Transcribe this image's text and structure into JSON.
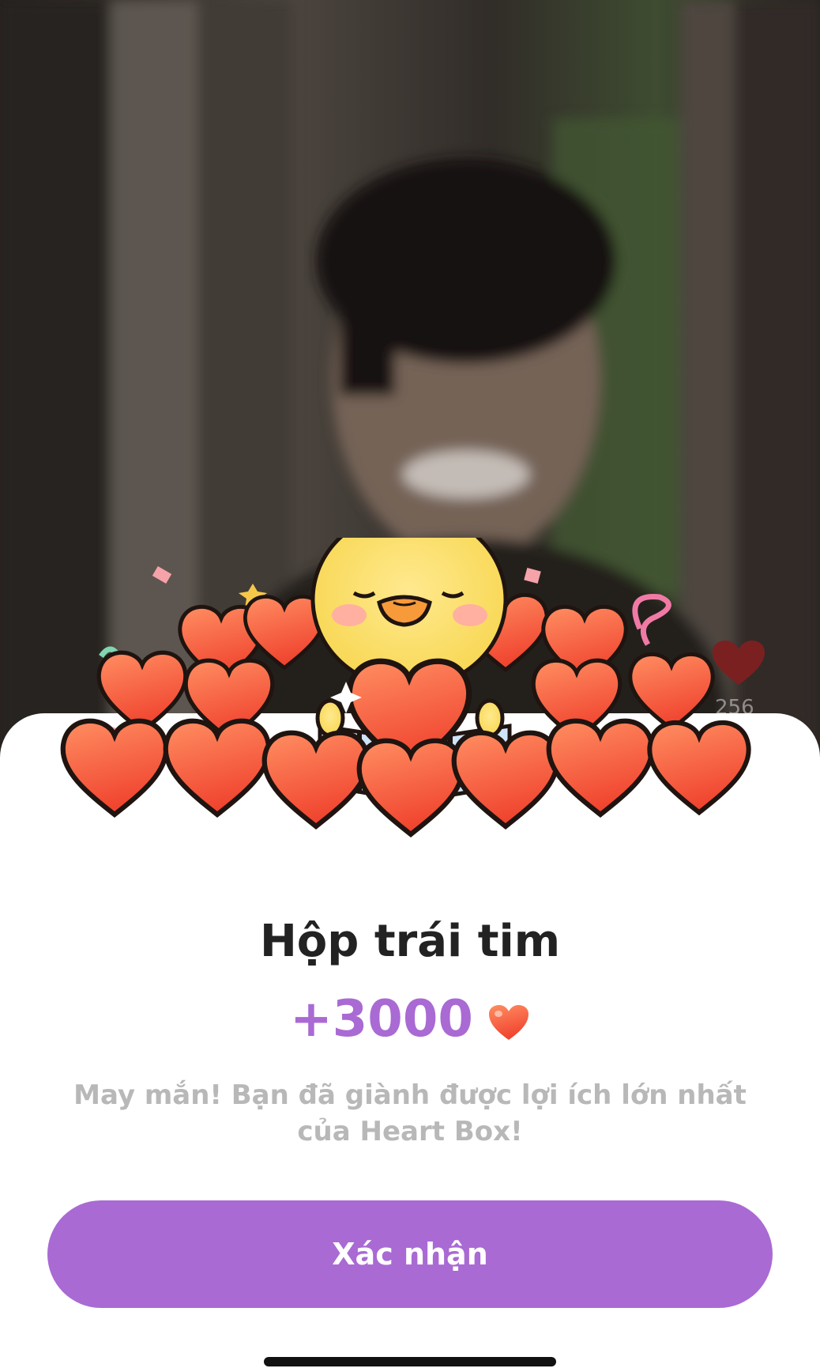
{
  "background": {
    "like_icon": "heart-icon",
    "like_count": "256"
  },
  "popup": {
    "illustration_icon": "chick-holding-heart-icon",
    "title": "Hộp trái tim",
    "reward_amount": "+3000",
    "reward_icon": "heart-icon",
    "message": "May mắn! Bạn đã giành được lợi ích lớn nhất của Heart Box!",
    "confirm_label": "Xác nhận"
  },
  "colors": {
    "accent": "#a96ad4",
    "title": "#222222",
    "message": "#b8b8b8",
    "heart": "#f0523a"
  }
}
